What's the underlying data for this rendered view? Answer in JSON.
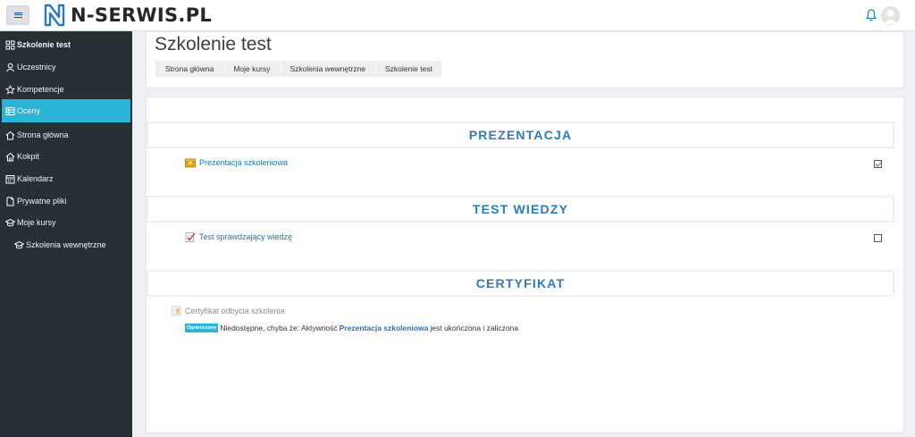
{
  "brand": {
    "name": "N-SERWIS.PL",
    "color": "#2b7bb9"
  },
  "colors": {
    "sidebar_bg": "#263035",
    "active": "#2bb4d6",
    "link": "#2674b0",
    "section_title": "#2b7bb9"
  },
  "sidebar": {
    "items": [
      {
        "label": "Szkolenie test",
        "icon": "grid-icon"
      },
      {
        "label": "Uczestnicy",
        "icon": "users-icon"
      },
      {
        "label": "Kompetencje",
        "icon": "star-icon"
      },
      {
        "label": "Oceny",
        "icon": "table-icon"
      },
      {
        "label": "Strona główna",
        "icon": "home-icon"
      },
      {
        "label": "Kokpit",
        "icon": "dashboard-home-icon"
      },
      {
        "label": "Kalendarz",
        "icon": "calendar-icon"
      },
      {
        "label": "Prywatne pliki",
        "icon": "file-icon"
      },
      {
        "label": "Moje kursy",
        "icon": "graduation-cap-icon"
      },
      {
        "label": "Szkolenia wewnętrzne",
        "icon": "graduation-cap-icon"
      }
    ]
  },
  "header": {
    "title": "Szkolenie test",
    "breadcrumb": [
      "Strona główna",
      "Moje kursy",
      "Szkolenia wewnętrzne",
      "Szkolenie test"
    ]
  },
  "sections": [
    {
      "title": "PREZENTACJA",
      "activity": {
        "name": "Prezentacja szkoleniowa",
        "icon": "package-icon",
        "completed": true
      }
    },
    {
      "title": "TEST WIEDZY",
      "activity": {
        "name": "Test sprawdzający wiedzę",
        "icon": "quiz-icon",
        "completed": false
      }
    },
    {
      "title": "CERTYFIKAT",
      "activity": {
        "name": "Certyfikat odbycia szkolenia",
        "icon": "certificate-icon"
      },
      "restriction": {
        "badge": "Ograniczony",
        "text_before": "Niedostępne, chyba że: Aktywność",
        "link": "Prezentacja szkoleniowa",
        "text_after": "jest ukończona i zaliczona"
      }
    }
  ]
}
